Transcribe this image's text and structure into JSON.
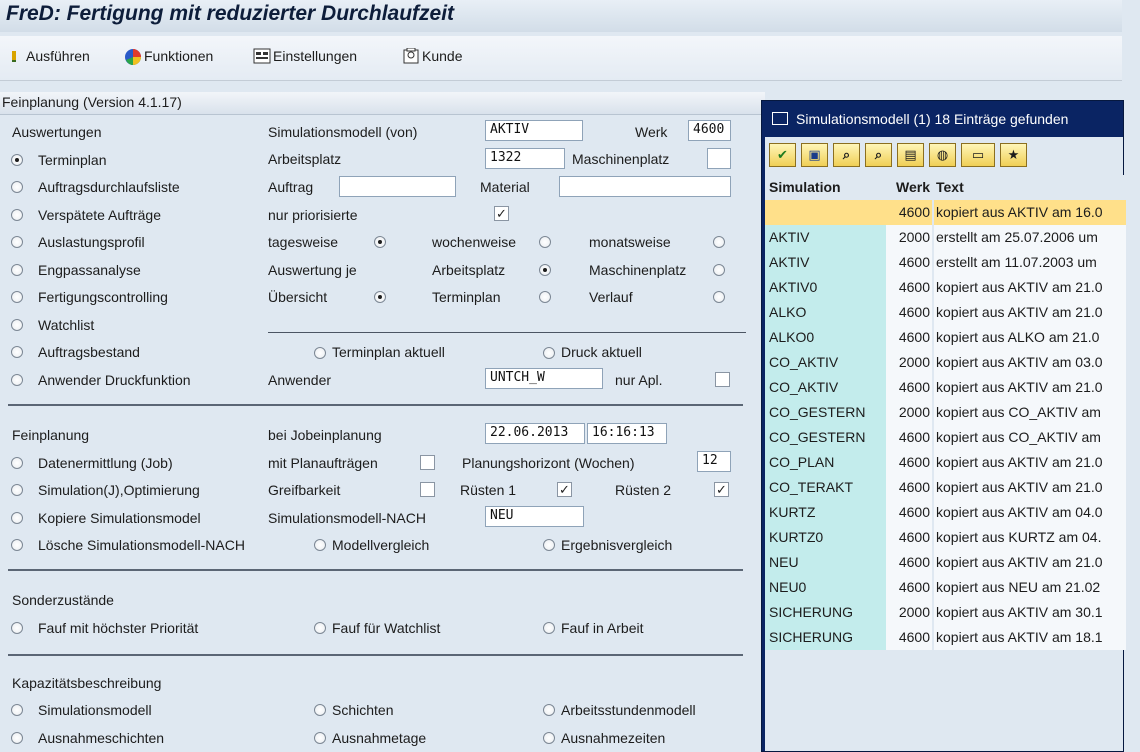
{
  "app": {
    "title": "FreD: Fertigung mit reduzierter Durchlaufzeit"
  },
  "toolbar": {
    "items": [
      {
        "label": "Ausführen",
        "icon": "execute-icon"
      },
      {
        "label": "Funktionen",
        "icon": "functions-icon"
      },
      {
        "label": "Einstellungen",
        "icon": "settings-icon"
      },
      {
        "label": "Kunde",
        "icon": "customer-icon"
      }
    ]
  },
  "panel": {
    "title": "Feinplanung (Version 4.1.17)"
  },
  "auswertungen": {
    "heading": "Auswertungen",
    "options": [
      {
        "label": "Terminplan",
        "selected": true
      },
      {
        "label": "Auftragsdurchlaufsliste",
        "selected": false
      },
      {
        "label": "Verspätete Aufträge",
        "selected": false
      },
      {
        "label": "Auslastungsprofil",
        "selected": false
      },
      {
        "label": "Engpassanalyse",
        "selected": false
      },
      {
        "label": "Fertigungscontrolling",
        "selected": false
      },
      {
        "label": "Watchlist",
        "selected": false
      },
      {
        "label": "Auftragsbestand",
        "selected": false
      },
      {
        "label": "Anwender Druckfunktion",
        "selected": false
      }
    ]
  },
  "params": {
    "simmodell_label": "Simulationsmodell (von)",
    "simmodell_value": "AKTIV",
    "werk_label": "Werk",
    "werk_value": "4600",
    "arbeitsplatz_label": "Arbeitsplatz",
    "arbeitsplatz_value": "1322",
    "maschinenplatz_label": "Maschinenplatz",
    "maschinenplatz_value": "",
    "auftrag_label": "Auftrag",
    "auftrag_value": "",
    "material_label": "Material",
    "material_value": "",
    "nur_prio_label": "nur priorisierte",
    "nur_prio_checked": true,
    "tagesweise_label": "tagesweise",
    "tagesweise": true,
    "wochenweise_label": "wochenweise",
    "wochenweise": false,
    "monatsweise_label": "monatsweise",
    "monatsweise": false,
    "auswertung_je_label": "Auswertung je",
    "je_arbeitsplatz_label": "Arbeitsplatz",
    "je_arbeitsplatz": true,
    "je_maschinenplatz_label": "Maschinenplatz",
    "je_maschinenplatz": false,
    "uebersicht_label": "Übersicht",
    "uebersicht": true,
    "terminplan_label": "Terminplan",
    "terminplan": false,
    "verlauf_label": "Verlauf",
    "verlauf": false,
    "terminplan_aktuell_label": "Terminplan aktuell",
    "druck_aktuell_label": "Druck aktuell",
    "anwender_label": "Anwender",
    "anwender_value": "UNTCH_W",
    "nur_apl_label": "nur Apl.",
    "nur_apl_checked": false
  },
  "feinplanung": {
    "heading": "Feinplanung",
    "bei_job_label": "bei Jobeinplanung",
    "date_value": "22.06.2013",
    "time_value": "16:16:13",
    "options": [
      {
        "label": "Datenermittlung (Job)",
        "selected": false
      },
      {
        "label": "Simulation(J),Optimierung",
        "selected": false
      },
      {
        "label": "Kopiere Simulationsmodel",
        "selected": false
      },
      {
        "label": "Lösche Simulationsmodell-NACH",
        "selected": false
      }
    ],
    "mit_plan_label": "mit Planaufträgen",
    "mit_plan_checked": false,
    "horizont_label": "Planungshorizont (Wochen)",
    "horizont_value": "12",
    "greif_label": "Greifbarkeit",
    "greif_checked": false,
    "ruesten1_label": "Rüsten 1",
    "ruesten1_checked": true,
    "ruesten2_label": "Rüsten 2",
    "ruesten2_checked": true,
    "nach_label": "Simulationsmodell-NACH",
    "nach_value": "NEU",
    "modellvergleich_label": "Modellvergleich",
    "ergebnisvergleich_label": "Ergebnisvergleich"
  },
  "sonder": {
    "heading": "Sonderzustände",
    "opt1": "Fauf mit höchster Priorität",
    "opt2": "Fauf für Watchlist",
    "opt3": "Fauf in Arbeit"
  },
  "kapazitaet": {
    "heading": "Kapazitätsbeschreibung",
    "opt1": "Simulationsmodell",
    "opt2": "Schichten",
    "opt3": "Arbeitsstundenmodell",
    "opt4": "Ausnahmeschichten",
    "opt5": "Ausnahmetage",
    "opt6": "Ausnahmezeiten"
  },
  "popup": {
    "title": "Simulationsmodell (1)   18 Einträge gefunden",
    "buttons": [
      "✔",
      "▣",
      "⌕",
      "⌕",
      "▤",
      "◍",
      "▭",
      "★"
    ],
    "columns": [
      "Simulation",
      "Werk",
      "Text"
    ],
    "rows": [
      {
        "sim": "",
        "werk": "4600",
        "text": "kopiert aus AKTIV am 16.0",
        "selected": true
      },
      {
        "sim": "AKTIV",
        "werk": "2000",
        "text": "erstellt am 25.07.2006 um"
      },
      {
        "sim": "AKTIV",
        "werk": "4600",
        "text": "erstellt am 11.07.2003 um"
      },
      {
        "sim": "AKTIV0",
        "werk": "4600",
        "text": "kopiert aus AKTIV am 21.0"
      },
      {
        "sim": "ALKO",
        "werk": "4600",
        "text": "kopiert aus AKTIV am 21.0"
      },
      {
        "sim": "ALKO0",
        "werk": "4600",
        "text": "kopiert aus ALKO am 21.0"
      },
      {
        "sim": "CO_AKTIV",
        "werk": "2000",
        "text": "kopiert aus AKTIV am 03.0"
      },
      {
        "sim": "CO_AKTIV",
        "werk": "4600",
        "text": "kopiert aus AKTIV am 21.0"
      },
      {
        "sim": "CO_GESTERN",
        "werk": "2000",
        "text": "kopiert aus CO_AKTIV am"
      },
      {
        "sim": "CO_GESTERN",
        "werk": "4600",
        "text": "kopiert aus CO_AKTIV am"
      },
      {
        "sim": "CO_PLAN",
        "werk": "4600",
        "text": "kopiert aus AKTIV am 21.0"
      },
      {
        "sim": "CO_TERAKT",
        "werk": "4600",
        "text": "kopiert aus AKTIV am 21.0"
      },
      {
        "sim": "KURTZ",
        "werk": "4600",
        "text": "kopiert aus AKTIV am 04.0"
      },
      {
        "sim": "KURTZ0",
        "werk": "4600",
        "text": "kopiert aus KURTZ am 04."
      },
      {
        "sim": "NEU",
        "werk": "4600",
        "text": "kopiert aus AKTIV am 21.0"
      },
      {
        "sim": "NEU0",
        "werk": "4600",
        "text": "kopiert aus NEU am 21.02"
      },
      {
        "sim": "SICHERUNG",
        "werk": "2000",
        "text": "kopiert aus AKTIV am 30.1"
      },
      {
        "sim": "SICHERUNG",
        "werk": "4600",
        "text": "kopiert aus AKTIV am 18.1"
      }
    ]
  }
}
